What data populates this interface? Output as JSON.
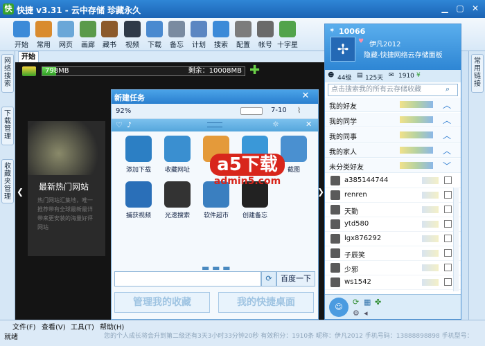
{
  "window": {
    "title": "快捷 v3.31 - 云中存储 珍藏永久",
    "min": "▁",
    "max": "▢",
    "close": "✕"
  },
  "toolbar": [
    {
      "label": "开始",
      "icon": "search-icon",
      "color": "#3b8ad8"
    },
    {
      "label": "常用",
      "icon": "signpost-icon",
      "color": "#d98b2e"
    },
    {
      "label": "网页",
      "icon": "webpage-icon",
      "color": "#6aa7d8"
    },
    {
      "label": "画廊",
      "icon": "gallery-icon",
      "color": "#5a9a4a"
    },
    {
      "label": "藏书",
      "icon": "books-icon",
      "color": "#8b5a2b"
    },
    {
      "label": "视频",
      "icon": "film-icon",
      "color": "#2f3a48"
    },
    {
      "label": "下载",
      "icon": "download-icon",
      "color": "#4a8ad0"
    },
    {
      "label": "备忘",
      "icon": "notepad-icon",
      "color": "#7a8ba0"
    },
    {
      "label": "计划",
      "icon": "calendar-icon",
      "color": "#5b86c2"
    },
    {
      "label": "搜索",
      "icon": "magnifier-icon",
      "color": "#3b8ad8"
    },
    {
      "label": "配置",
      "icon": "gear-icon",
      "color": "#7c7c7c"
    },
    {
      "label": "帐号",
      "icon": "lock-icon",
      "color": "#6a6a6a"
    },
    {
      "label": "十字星",
      "icon": "star-icon",
      "color": "#52a34b"
    }
  ],
  "left_tabs": [
    "网络搜索",
    "下载管理",
    "收藏夹管理"
  ],
  "right_tab": "常用链接",
  "tab_start": "开始",
  "storage": {
    "used": "798MB",
    "remaining": "剩余：10008MB",
    "fraction": 0.07
  },
  "panel": {
    "title": "最新热门网站",
    "desc": "热门网站汇集地，唯一推荐带有全球最新最详带来更安装的海量好评网站"
  },
  "dialog": {
    "title": "新建任务",
    "percent": "92%",
    "clock": "7-10",
    "items": [
      {
        "label": "添加下载",
        "icon": "add-download-icon",
        "color": "#2c7fc4"
      },
      {
        "label": "收藏网址",
        "icon": "bookmark-web-icon",
        "color": "#3a8fd0"
      },
      {
        "label": "",
        "icon": "arrow-icon",
        "color": "#e49a3a"
      },
      {
        "label": "",
        "icon": "globe-icon",
        "color": "#3a98d8"
      },
      {
        "label": "截图",
        "icon": "screenshot-icon",
        "color": "#4a90d0"
      },
      {
        "label": "捕获视频",
        "icon": "capture-video-icon",
        "color": "#2a6fb8"
      },
      {
        "label": "光速搜索",
        "icon": "fast-search-icon",
        "color": "#333333"
      },
      {
        "label": "软件超市",
        "icon": "software-store-icon",
        "color": "#3a7fc0"
      },
      {
        "label": "创建备忘",
        "icon": "create-memo-icon",
        "color": "#222222"
      }
    ],
    "search_button": "百度一下",
    "btn1": "管理我的收藏",
    "btn2": "我的快捷桌面"
  },
  "watermark": {
    "top": "a5下载",
    "url": "admin5.com"
  },
  "qq": {
    "number": "10066",
    "nickname": "伊凡2012",
    "signature": "隐藏-快捷网络云存储面板",
    "stats": [
      "44级",
      "125天",
      "1910"
    ],
    "search_placeholder": "点击搜索我的所有云存储收藏",
    "groups": [
      "我的好友",
      "我的同学",
      "我的同事",
      "我的家人",
      "未分类好友"
    ],
    "friends": [
      "a385144744",
      "renren",
      "天勤",
      "ytd580",
      "lgx876292",
      "子辰笑",
      "少邪",
      "ws1542"
    ]
  },
  "menu": [
    "文件(F)",
    "查看(V)",
    "工具(T)",
    "帮助(H)"
  ],
  "status": "就绪",
  "marquee": "您的个人成长将会升到第二级还有3天3小时33分钟20秒  有效积分：1910条  昵称：伊凡2012 手机号码：13888898898 手机型号："
}
